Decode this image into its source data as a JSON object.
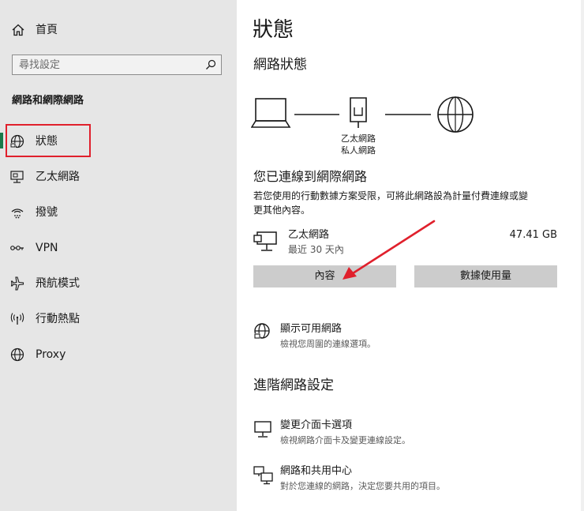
{
  "sidebar": {
    "home_label": "首頁",
    "search_placeholder": "尋找設定",
    "section_title": "網路和網際網路",
    "items": [
      {
        "label": "狀態"
      },
      {
        "label": "乙太網路"
      },
      {
        "label": "撥號"
      },
      {
        "label": "VPN"
      },
      {
        "label": "飛航模式"
      },
      {
        "label": "行動熱點"
      },
      {
        "label": "Proxy"
      }
    ]
  },
  "main": {
    "page_title": "狀態",
    "network_status_heading": "網路狀態",
    "diagram": {
      "adapter_name": "乙太網路",
      "adapter_type": "私人網路"
    },
    "connected_heading": "您已連線到網際網路",
    "connected_desc_line1": "若您使用的行動數據方案受限，可將此網路設為計量付費連線或變",
    "connected_desc_line2": "更其他內容。",
    "connection": {
      "name": "乙太網路",
      "period": "最近 30 天內",
      "usage": "47.41 GB"
    },
    "buttons": {
      "properties": "內容",
      "data_usage": "數據使用量"
    },
    "show_networks": {
      "title": "顯示可用網路",
      "desc": "檢視您周圍的連線選項。"
    },
    "advanced_heading": "進階網路設定",
    "change_adapter": {
      "title": "變更介面卡選項",
      "desc": "檢視網路介面卡及變更連線設定。"
    },
    "sharing_center": {
      "title": "網路和共用中心",
      "desc": "對於您連線的網路，決定您要共用的項目。"
    }
  },
  "colors": {
    "sidebar_bg": "#e6e6e6",
    "selection_accent": "#1a7a4a",
    "highlight_box": "#e0202c",
    "annotation_arrow": "#e0202c",
    "button_bg": "#cccccc"
  }
}
